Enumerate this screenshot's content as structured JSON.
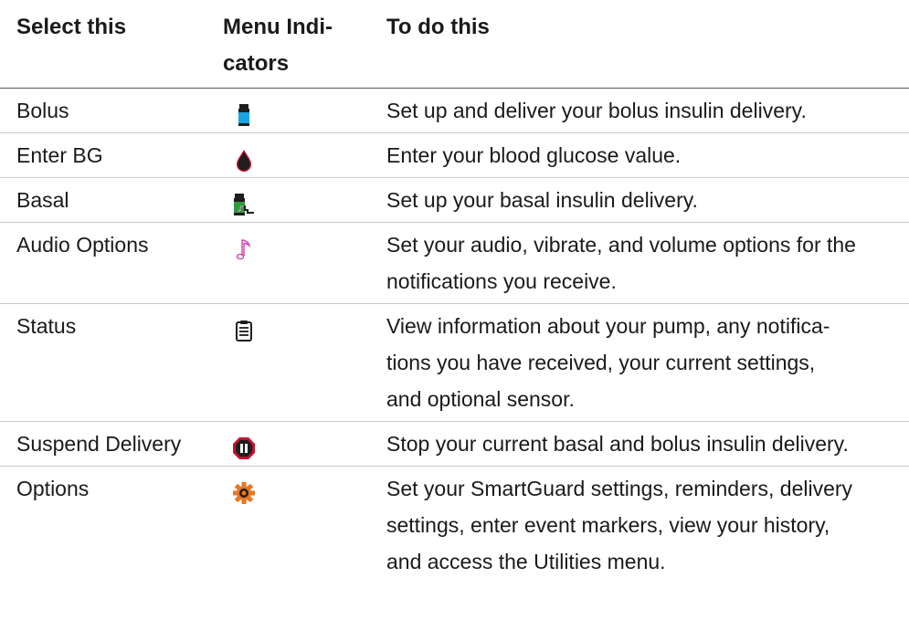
{
  "header": {
    "col1": "Select this",
    "col2": "Menu Indi-cators",
    "col3": "To do this"
  },
  "rows": [
    {
      "name": "Bolus",
      "icon": "bolus-vial-icon",
      "desc": "Set up and deliver your bolus insulin delivery."
    },
    {
      "name": "Enter BG",
      "icon": "blood-drop-icon",
      "desc": "Enter your blood glucose value."
    },
    {
      "name": "Basal",
      "icon": "basal-vial-icon",
      "desc": "Set up your basal insulin delivery."
    },
    {
      "name": "Audio Options",
      "icon": "music-note-icon",
      "desc": "Set your audio, vibrate, and volume options for the notifications you receive."
    },
    {
      "name": "Status",
      "icon": "clipboard-icon",
      "desc": "View information about your pump, any notifica-tions you have received, your current settings, and optional sensor."
    },
    {
      "name": "Suspend Delivery",
      "icon": "stop-pause-icon",
      "desc": "Stop your current basal and bolus insulin delivery."
    },
    {
      "name": "Options",
      "icon": "gear-icon",
      "desc": "Set your SmartGuard settings, reminders, delivery settings, enter event markers, view your history, and access the Utilities menu."
    }
  ],
  "colors": {
    "bolus_cap": "#1e1e1e",
    "bolus_body": "#1aa3e0",
    "drop": "#c8102e",
    "basal_body": "#2e9b3a",
    "note": "#d63fb0",
    "stop": "#c8102e",
    "gear": "#e87722"
  }
}
